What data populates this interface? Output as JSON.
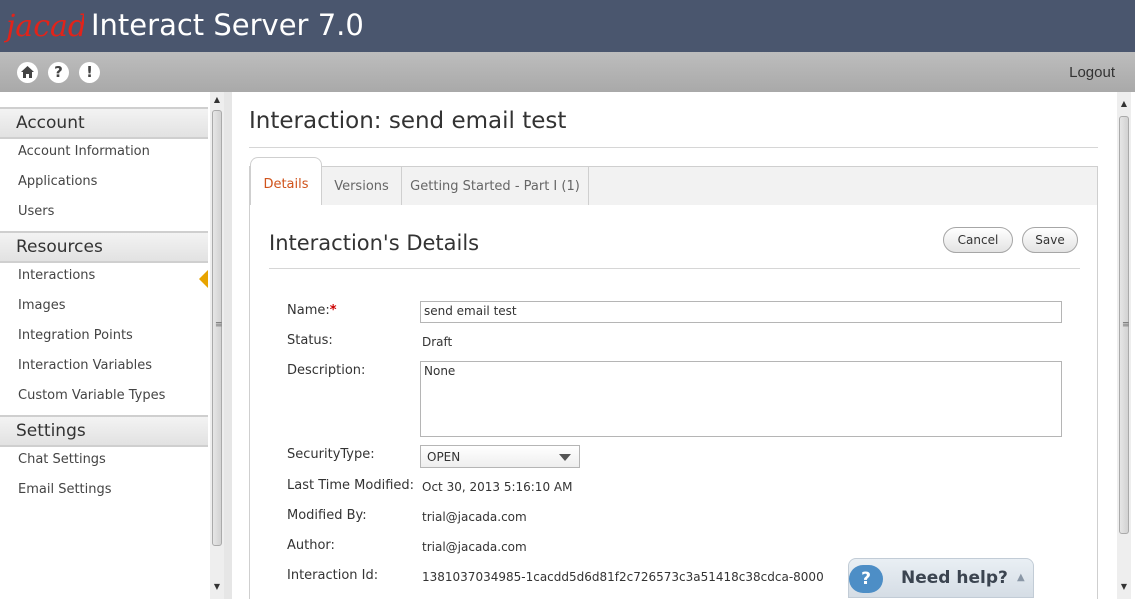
{
  "header": {
    "logo_text": "jacada",
    "title": "Interact Server 7.0"
  },
  "toolbar": {
    "icons": {
      "home": "home-icon",
      "help": "?",
      "alert": "!"
    },
    "logout_label": "Logout"
  },
  "sidebar": {
    "sections": [
      {
        "title": "Account",
        "items": [
          "Account Information",
          "Applications",
          "Users"
        ]
      },
      {
        "title": "Resources",
        "items": [
          "Interactions",
          "Images",
          "Integration Points",
          "Interaction Variables",
          "Custom Variable Types"
        ]
      },
      {
        "title": "Settings",
        "items": [
          "Chat Settings",
          "Email Settings"
        ]
      }
    ],
    "active_item": "Interactions",
    "active_color": "#e8a400"
  },
  "main": {
    "page_title": "Interaction: send email test",
    "tabs": [
      "Details",
      "Versions",
      "Getting Started - Part I (1)"
    ],
    "active_tab": "Details",
    "section_title": "Interaction's Details",
    "buttons": {
      "cancel": "Cancel",
      "save": "Save"
    },
    "form": {
      "name_label": "Name:",
      "required_mark": "*",
      "name_value": "send email test",
      "status_label": "Status:",
      "status_value": "Draft",
      "description_label": "Description:",
      "description_value": "None",
      "security_label": "SecurityType:",
      "security_value": "OPEN",
      "modified_label": "Last Time Modified:",
      "modified_value": "Oct 30, 2013 5:16:10 AM",
      "modified_by_label": "Modified By:",
      "modified_by_value": "trial@jacada.com",
      "author_label": "Author:",
      "author_value": "trial@jacada.com",
      "id_label": "Interaction Id:",
      "id_value": "1381037034985-1cacdd5d6d81f2c726573c3a51418c38cdca-8000"
    }
  },
  "help_widget": {
    "icon": "?",
    "label": "Need help?"
  },
  "colors": {
    "header_bg": "#4a566e",
    "toolbar_bg": "#b0b0b0",
    "active_tab_text": "#d0531b",
    "required": "#cc0000"
  }
}
